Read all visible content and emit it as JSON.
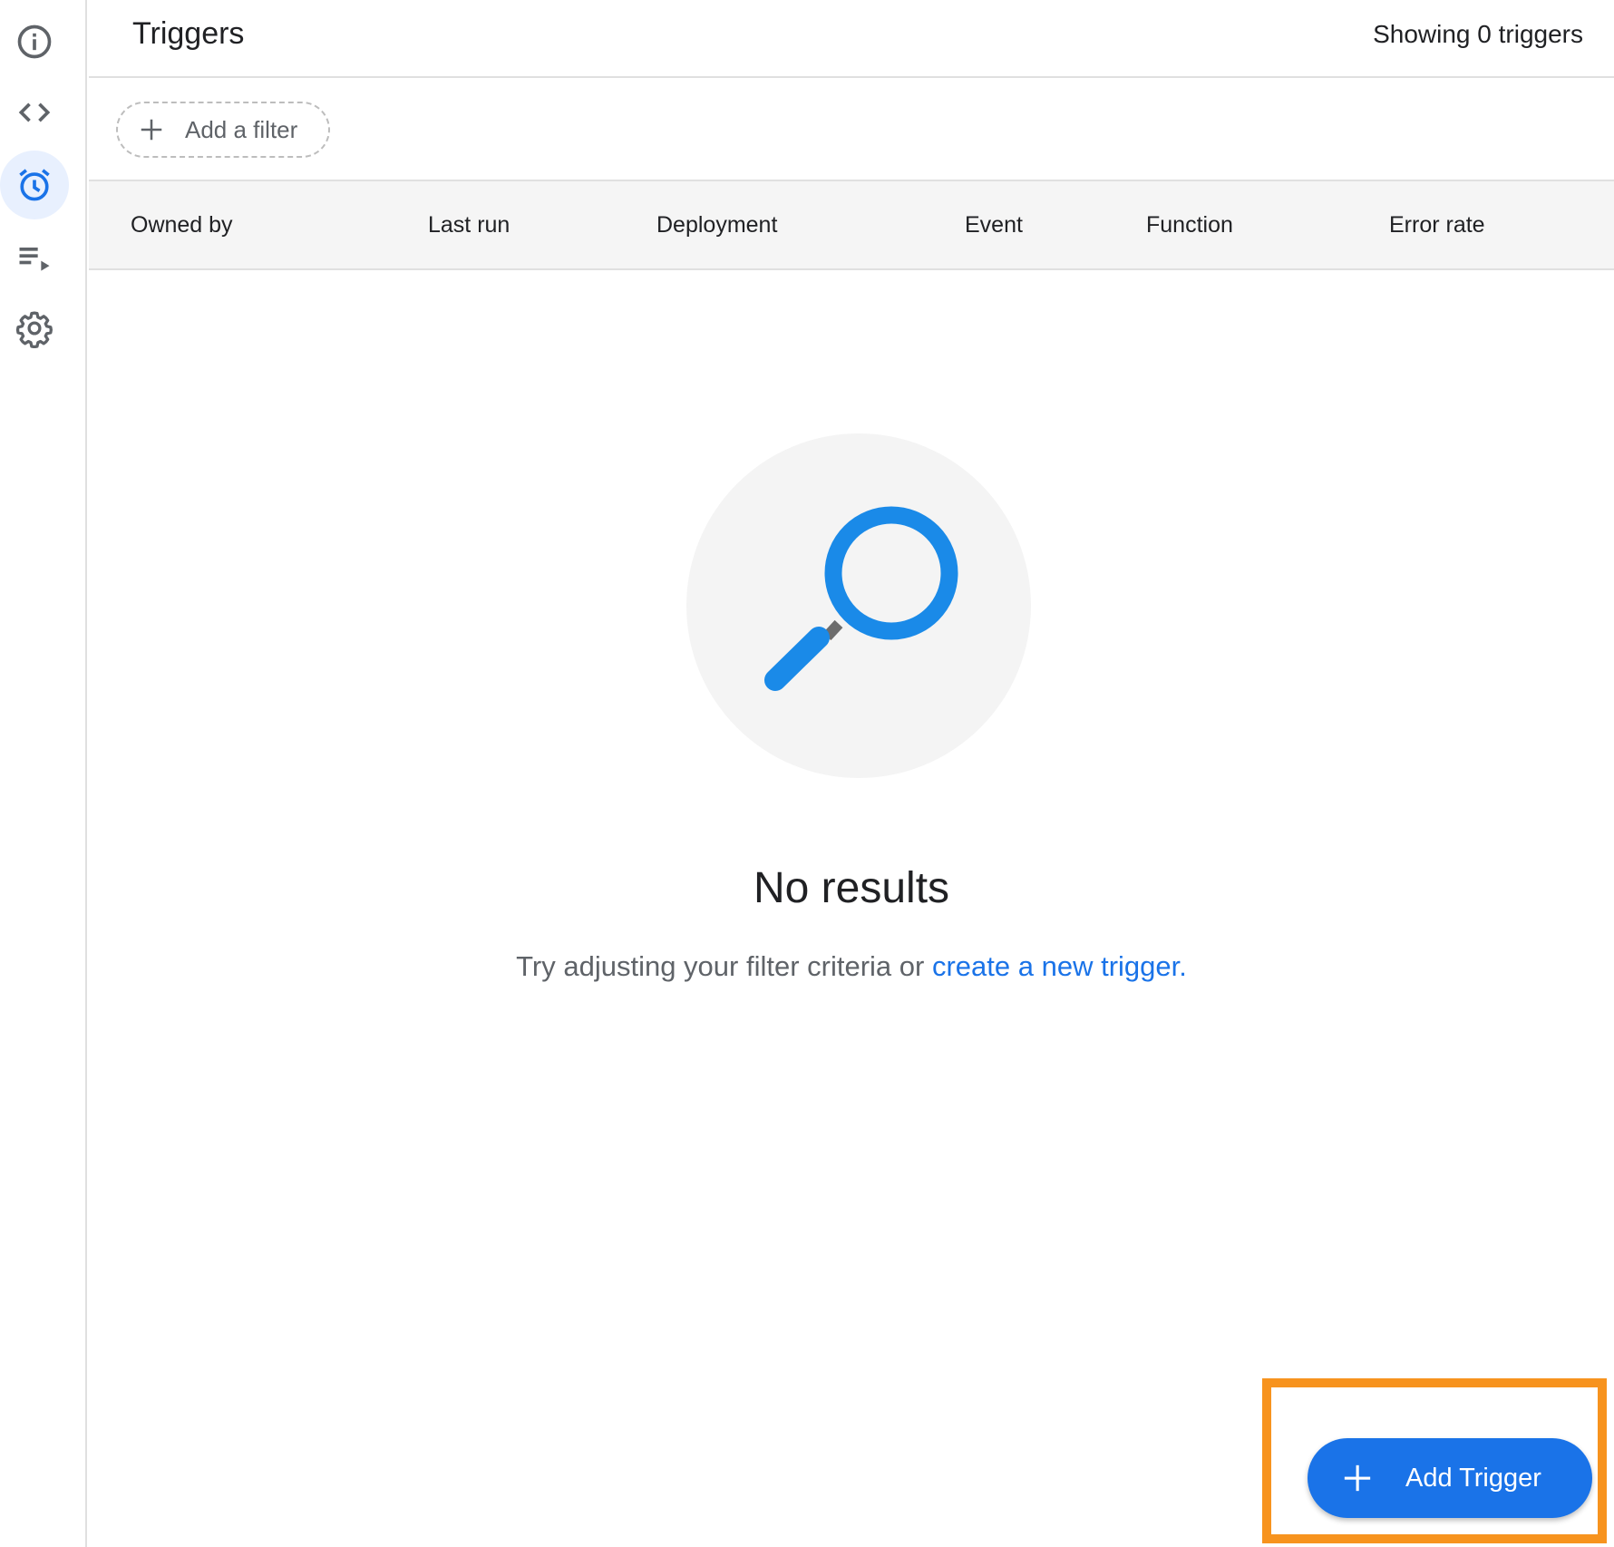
{
  "rail": {
    "items": [
      {
        "icon": "info-icon"
      },
      {
        "icon": "code-icon"
      },
      {
        "icon": "alarm-clock-icon",
        "active": true
      },
      {
        "icon": "playlist-play-icon"
      },
      {
        "icon": "gear-icon"
      }
    ]
  },
  "header": {
    "title": "Triggers",
    "count_text": "Showing 0 triggers"
  },
  "filter": {
    "add_label": "Add a filter"
  },
  "table": {
    "columns": [
      "Owned by",
      "Last run",
      "Deployment",
      "Event",
      "Function",
      "Error rate"
    ]
  },
  "empty_state": {
    "title": "No results",
    "message": "Try adjusting your filter criteria or",
    "link": "create a new trigger."
  },
  "fab": {
    "label": "Add Trigger"
  },
  "colors": {
    "accent": "#1a73e8",
    "highlight": "#f7931e",
    "header_bg": "#f5f5f5",
    "active_rail_bg": "#e8f0fe"
  }
}
